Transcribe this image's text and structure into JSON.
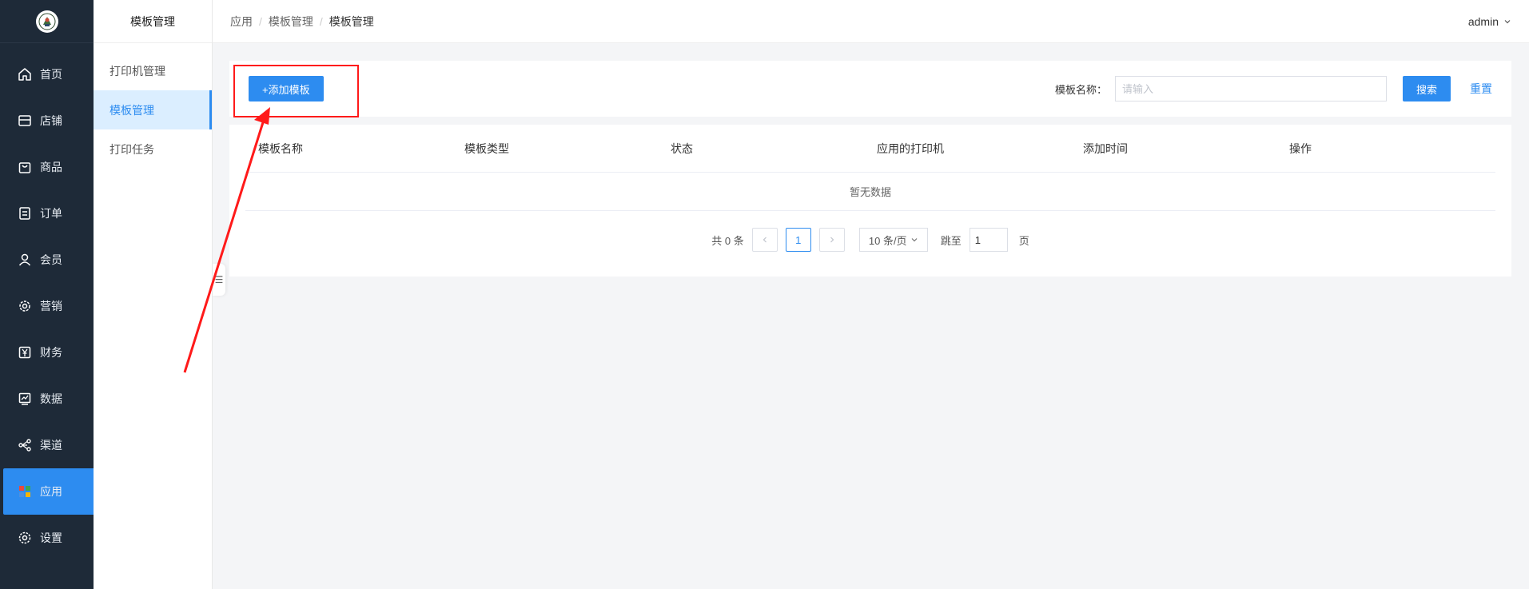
{
  "sidebar": {
    "items": [
      {
        "label": "首页",
        "icon": "home-icon"
      },
      {
        "label": "店铺",
        "icon": "store-icon"
      },
      {
        "label": "商品",
        "icon": "bag-icon"
      },
      {
        "label": "订单",
        "icon": "order-icon"
      },
      {
        "label": "会员",
        "icon": "user-icon"
      },
      {
        "label": "营销",
        "icon": "gear-icon"
      },
      {
        "label": "财务",
        "icon": "yen-icon"
      },
      {
        "label": "数据",
        "icon": "chart-icon"
      },
      {
        "label": "渠道",
        "icon": "share-icon"
      },
      {
        "label": "应用",
        "icon": "apps-icon"
      },
      {
        "label": "设置",
        "icon": "settings-icon"
      }
    ],
    "active_index": 9,
    "active_color": "#2d8cf0"
  },
  "subside": {
    "title": "模板管理",
    "items": [
      {
        "label": "打印机管理"
      },
      {
        "label": "模板管理"
      },
      {
        "label": "打印任务"
      }
    ],
    "active_index": 1
  },
  "header": {
    "breadcrumb": [
      "应用",
      "模板管理",
      "模板管理"
    ],
    "separator": "/",
    "user": "admin"
  },
  "toolbar": {
    "add_label": "+添加模板",
    "search_label": "模板名称：",
    "search_placeholder": "请输入",
    "search_button": "搜索",
    "reset_button": "重置"
  },
  "table": {
    "columns": [
      "模板名称",
      "模板类型",
      "状态",
      "应用的打印机",
      "添加时间",
      "操作"
    ],
    "empty_text": "暂无数据"
  },
  "pager": {
    "total_text": "共 0 条",
    "current_page": "1",
    "page_size": "10 条/页",
    "jump_label": "跳至",
    "jump_value": "1",
    "page_suffix": "页"
  },
  "annotation_color": "#ff1a1a"
}
